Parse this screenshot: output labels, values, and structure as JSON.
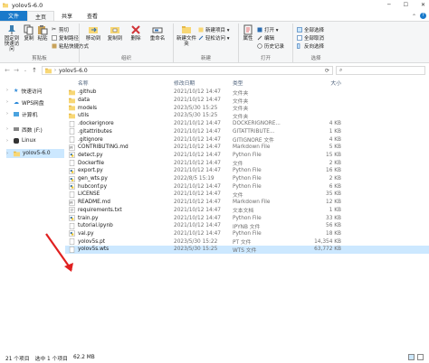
{
  "window": {
    "title": "yolov5-6.0"
  },
  "ribbon_tabs": [
    {
      "label": "文件"
    },
    {
      "label": "主页"
    },
    {
      "label": "共享"
    },
    {
      "label": "查看"
    }
  ],
  "ribbon": {
    "clipboard": {
      "label": "剪贴板",
      "pin_label": "固定到快速访问",
      "copy_label": "复制",
      "paste_label": "粘贴",
      "cut_label": "剪切",
      "copy_path_label": "复制路径",
      "paste_shortcut_label": "粘贴快捷方式"
    },
    "organize": {
      "label": "组织",
      "move_to_label": "移动到",
      "copy_to_label": "复制到",
      "delete_label": "删除",
      "rename_label": "重命名"
    },
    "new": {
      "label": "新建",
      "new_folder_label": "新建文件夹",
      "new_item_label": "新建项目 ▾",
      "easy_access_label": "轻松访问 ▾"
    },
    "open": {
      "label": "打开",
      "properties_label": "属性",
      "open_label": "打开 ▾",
      "edit_label": "编辑",
      "history_label": "历史记录"
    },
    "select": {
      "label": "选择",
      "select_all_label": "全部选择",
      "select_none_label": "全部取消",
      "invert_label": "反向选择"
    }
  },
  "address": {
    "path": "yolov5-6.0"
  },
  "nav_pane": [
    {
      "label": "快速访问"
    },
    {
      "label": "WPS网盘"
    },
    {
      "label": "计算机"
    },
    {
      "label": "西数 (F:)"
    },
    {
      "label": "Linux"
    },
    {
      "label": "yolov5-6.0"
    }
  ],
  "columns": {
    "name": "名称",
    "date": "修改日期",
    "type": "类型",
    "size": "大小"
  },
  "files": [
    {
      "name": ".github",
      "date": "2021/10/12 14:47",
      "type": "文件夹",
      "size": "",
      "kind": "folder"
    },
    {
      "name": "data",
      "date": "2021/10/12 14:47",
      "type": "文件夹",
      "size": "",
      "kind": "folder"
    },
    {
      "name": "models",
      "date": "2023/5/30 15:25",
      "type": "文件夹",
      "size": "",
      "kind": "folder"
    },
    {
      "name": "utils",
      "date": "2023/5/30 15:25",
      "type": "文件夹",
      "size": "",
      "kind": "folder"
    },
    {
      "name": ".dockerignore",
      "date": "2021/10/12 14:47",
      "type": "DOCKERIGNORE...",
      "size": "4 KB",
      "kind": "file"
    },
    {
      "name": ".gitattributes",
      "date": "2021/10/12 14:47",
      "type": "GITATTRIBUTE...",
      "size": "1 KB",
      "kind": "file"
    },
    {
      "name": ".gitignore",
      "date": "2021/10/12 14:47",
      "type": "GITIGNORE 文件",
      "size": "4 KB",
      "kind": "file"
    },
    {
      "name": "CONTRIBUTING.md",
      "date": "2021/10/12 14:47",
      "type": "Markdown File",
      "size": "5 KB",
      "kind": "md"
    },
    {
      "name": "detect.py",
      "date": "2021/10/12 14:47",
      "type": "Python File",
      "size": "15 KB",
      "kind": "py"
    },
    {
      "name": "Dockerfile",
      "date": "2021/10/12 14:47",
      "type": "文件",
      "size": "2 KB",
      "kind": "file"
    },
    {
      "name": "export.py",
      "date": "2021/10/12 14:47",
      "type": "Python File",
      "size": "16 KB",
      "kind": "py"
    },
    {
      "name": "gen_wts.py",
      "date": "2022/8/5 15:19",
      "type": "Python File",
      "size": "2 KB",
      "kind": "py"
    },
    {
      "name": "hubconf.py",
      "date": "2021/10/12 14:47",
      "type": "Python File",
      "size": "6 KB",
      "kind": "py"
    },
    {
      "name": "LICENSE",
      "date": "2021/10/12 14:47",
      "type": "文件",
      "size": "35 KB",
      "kind": "file"
    },
    {
      "name": "README.md",
      "date": "2021/10/12 14:47",
      "type": "Markdown File",
      "size": "12 KB",
      "kind": "md"
    },
    {
      "name": "requirements.txt",
      "date": "2021/10/12 14:47",
      "type": "文本文档",
      "size": "1 KB",
      "kind": "txt"
    },
    {
      "name": "train.py",
      "date": "2021/10/12 14:47",
      "type": "Python File",
      "size": "33 KB",
      "kind": "py"
    },
    {
      "name": "tutorial.ipynb",
      "date": "2021/10/12 14:47",
      "type": "IPYNB 文件",
      "size": "56 KB",
      "kind": "file"
    },
    {
      "name": "val.py",
      "date": "2021/10/12 14:47",
      "type": "Python File",
      "size": "18 KB",
      "kind": "py"
    },
    {
      "name": "yolov5s.pt",
      "date": "2023/5/30 15:22",
      "type": "PT 文件",
      "size": "14,354 KB",
      "kind": "file"
    },
    {
      "name": "yolov5s.wts",
      "date": "2023/5/30 15:25",
      "type": "WTS 文件",
      "size": "63,772 KB",
      "kind": "file",
      "selected": true
    }
  ],
  "status": {
    "count": "21 个项目",
    "selection": "选中 1 个项目",
    "size": "62.2 MB"
  },
  "colors": {
    "accent": "#1979ca",
    "selection": "#cce8ff",
    "folder": "#f8d775",
    "annotation_arrow": "#e02020"
  }
}
